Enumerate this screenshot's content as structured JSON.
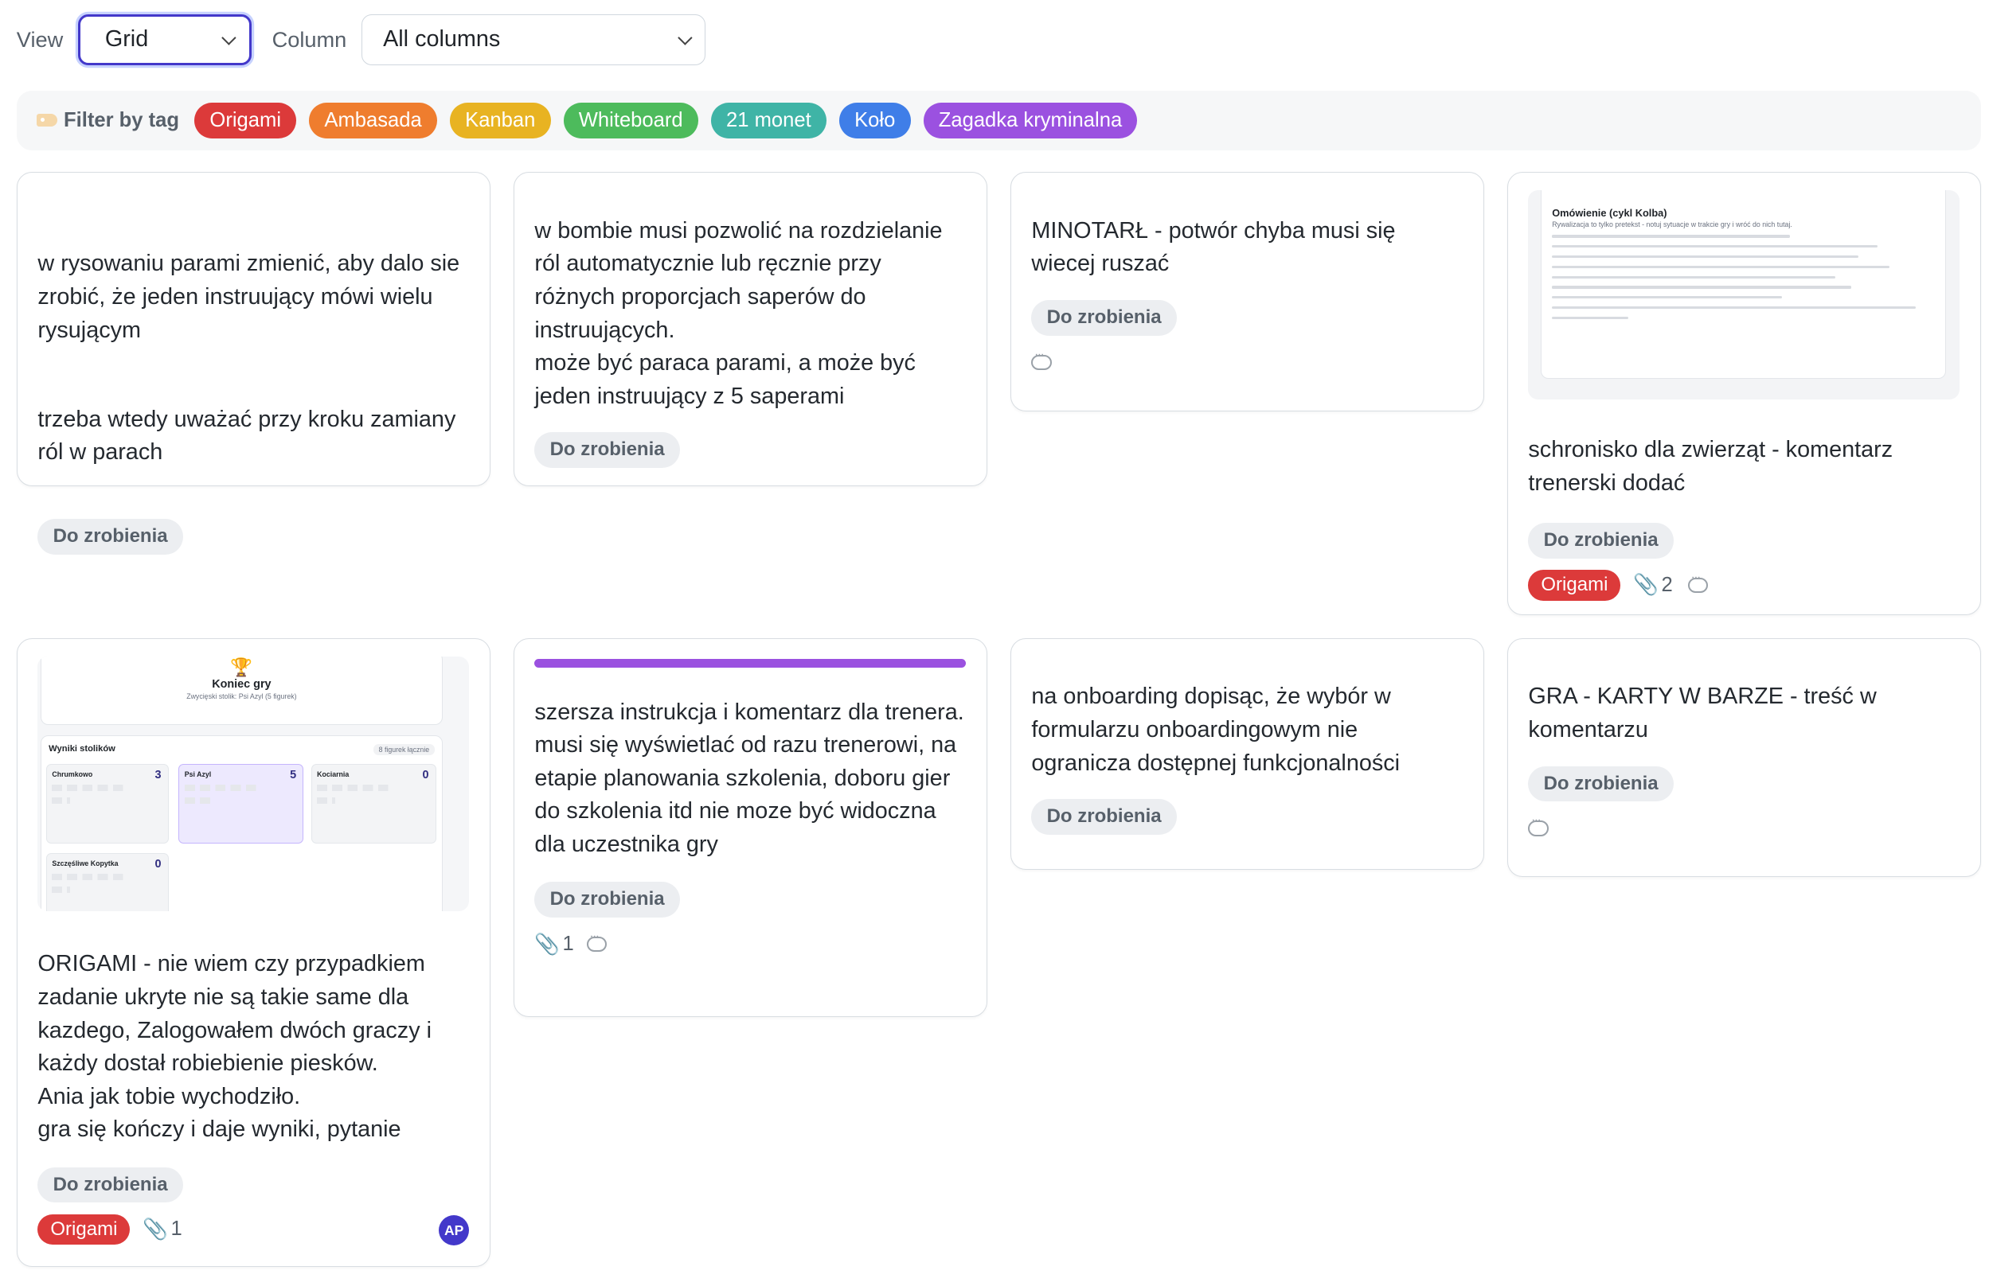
{
  "toolbar": {
    "view_label": "View",
    "view_value": "Grid",
    "column_label": "Column",
    "column_value": "All columns"
  },
  "filter": {
    "label": "Filter by tag",
    "tags": [
      {
        "name": "Origami",
        "color": "#dc3a3a"
      },
      {
        "name": "Ambasada",
        "color": "#ef7d2e"
      },
      {
        "name": "Kanban",
        "color": "#e8b322"
      },
      {
        "name": "Whiteboard",
        "color": "#4dbb5c"
      },
      {
        "name": "21 monet",
        "color": "#3fb4a6"
      },
      {
        "name": "Koło",
        "color": "#3f7ee8"
      },
      {
        "name": "Zagadka kryminalna",
        "color": "#9b51e0"
      }
    ]
  },
  "cards": [
    {
      "text_p1": "w rysowaniu parami zmienić, aby dalo sie zrobić, że jeden instruujący mówi wielu rysującym",
      "text_p2": "trzeba wtedy uważać przy kroku zamiany ról w parach",
      "status": "Do zrobienia"
    },
    {
      "text": "w bombie musi pozwolić na rozdzielanie ról automatycznie lub ręcznie przy różnych proporcjach saperów do instruujących.\nmoże być paraca parami, a może być jeden instruujący z 5 saperami",
      "status": "Do zrobienia"
    },
    {
      "text": "MINOTARŁ - potwór chyba musi się wiecej ruszać",
      "status": "Do zrobienia",
      "comment_icon": "comment-icon"
    },
    {
      "thumb_title": "Omówienie (cykl Kolba)",
      "thumb_sub": "Rywalizacja to tylko pretekst - notuj sytuacje w trakcie gry i wróć do nich tutaj.",
      "text": "schronisko dla zwierząt - komentarz trenerski dodać",
      "status": "Do zrobienia",
      "tag": "Origami",
      "attachments": "2"
    },
    {
      "thumb_title": "Koniec gry",
      "thumb_sub": "Zwycięski stolik: Psi Azyl (5 figurek)",
      "thumb_section": "Wyniki stolików",
      "thumb_badge": "8 figurek łącznie",
      "thumb_tables": [
        {
          "name": "Chrumkowo",
          "score": "3"
        },
        {
          "name": "Psi Azyl",
          "score": "5"
        },
        {
          "name": "Kociarnia",
          "score": "0"
        },
        {
          "name": "Szczęśliwe Kopytka",
          "score": "0"
        }
      ],
      "text": "ORIGAMI - nie wiem czy przypadkiem zadanie ukryte nie są takie same dla kazdego, Zalogowałem dwóch graczy i każdy dostał robiebienie piesków.\nAnia jak tobie wychodziło.\ngra się kończy i daje wyniki, pytanie",
      "status": "Do zrobienia",
      "tag": "Origami",
      "attachments": "1",
      "avatar": "AP"
    },
    {
      "accent": "#9b51e0",
      "text": "szersza instrukcja i komentarz dla trenera. musi się wyświetlać od razu trenerowi, na etapie planowania szkolenia, doboru gier do szkolenia itd nie moze być widoczna dla uczestnika gry",
      "status": "Do zrobienia",
      "attachments": "1"
    },
    {
      "text": "na onboarding dopisąc, że wybór w formularzu onboardingowym nie ogranicza dostępnej funkcjonalności",
      "status": "Do zrobienia"
    },
    {
      "text": "GRA - KARTY W BARZE - treść w komentarzu",
      "status": "Do zrobienia",
      "comment_icon": "comment-icon"
    }
  ]
}
